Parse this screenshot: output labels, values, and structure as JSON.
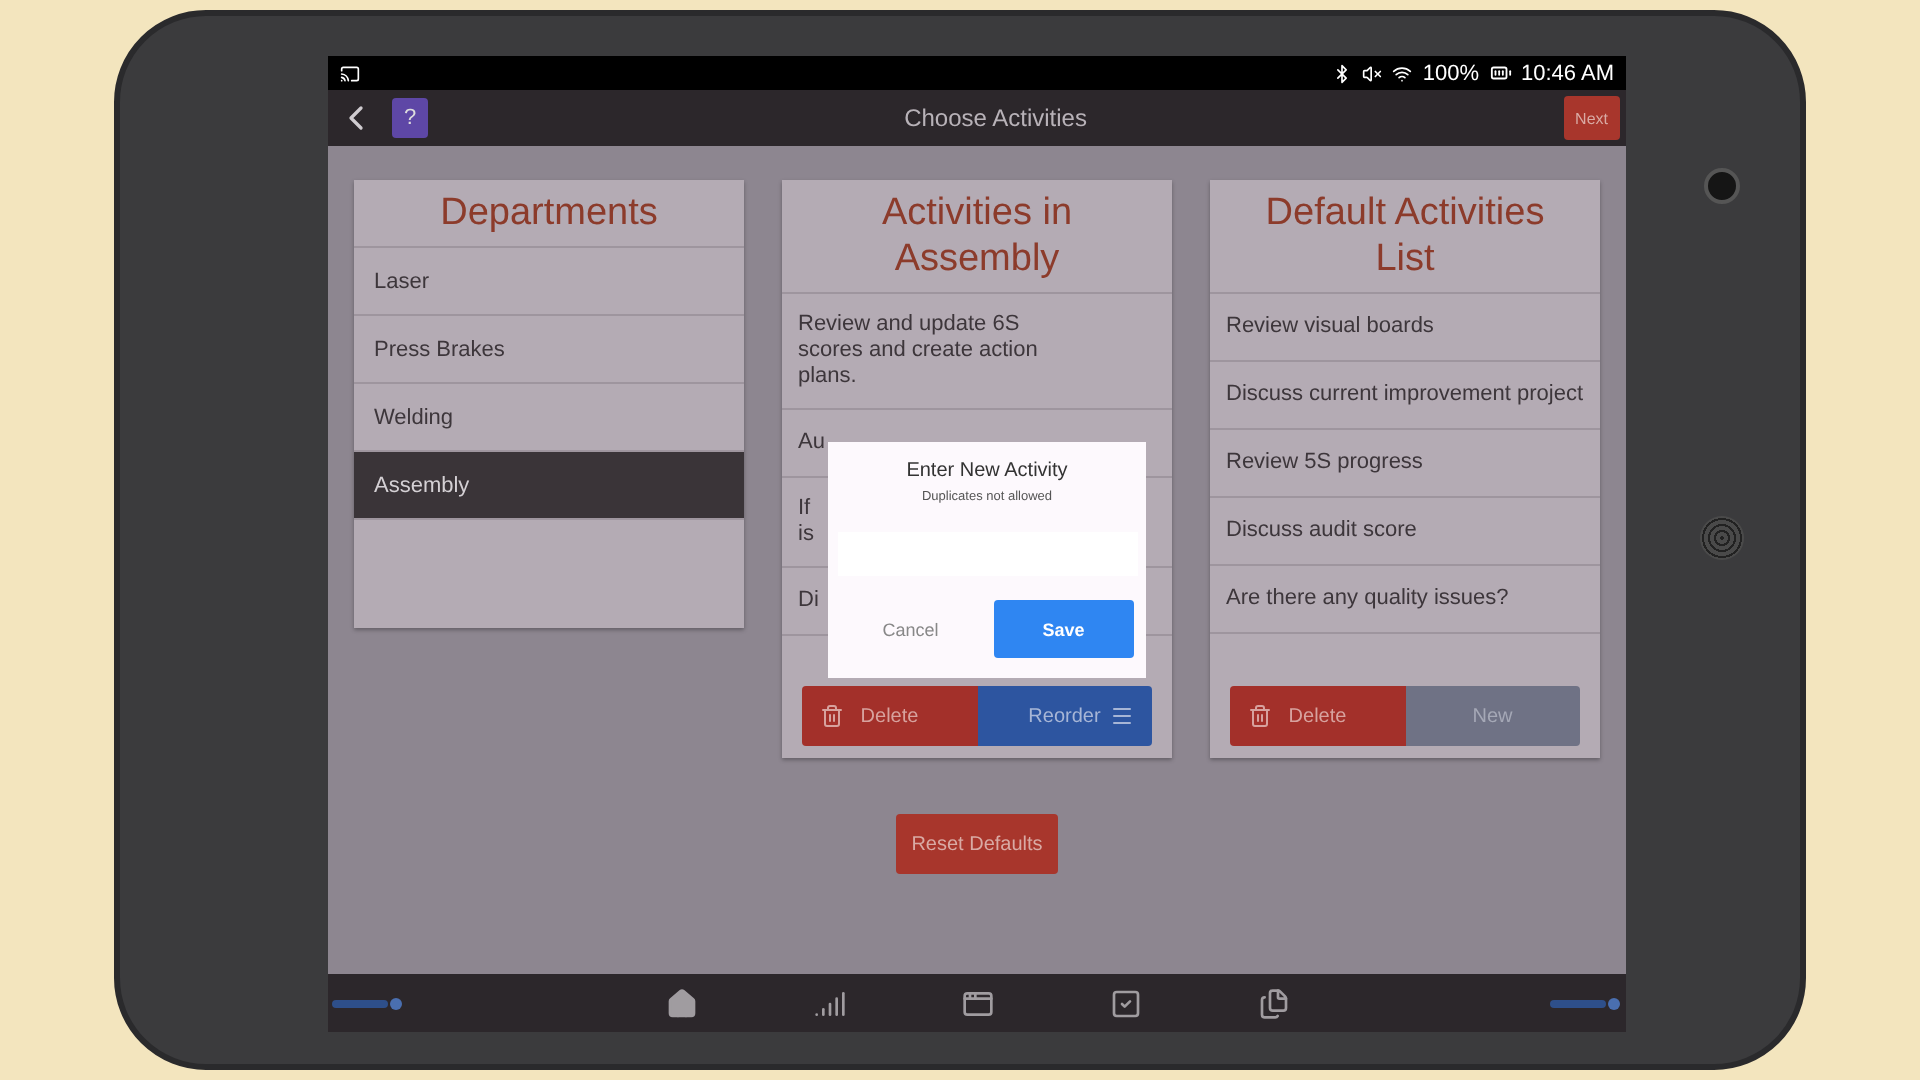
{
  "status_bar": {
    "battery": "100%",
    "time": "10:46 AM"
  },
  "top_bar": {
    "help": "?",
    "title": "Choose Activities",
    "next": "Next"
  },
  "departments": {
    "title": "Departments",
    "items": [
      {
        "label": "Laser",
        "selected": false
      },
      {
        "label": "Press Brakes",
        "selected": false
      },
      {
        "label": "Welding",
        "selected": false
      },
      {
        "label": "Assembly",
        "selected": true
      }
    ]
  },
  "activities": {
    "title": "Activities in Assembly",
    "items": [
      {
        "lines": [
          "Review and update 6S scores and create action plans."
        ]
      },
      {
        "lines": [
          "Au"
        ]
      },
      {
        "lines": [
          "If",
          "is"
        ]
      },
      {
        "lines": [
          "Di"
        ]
      }
    ],
    "buttons": [
      {
        "label": "Delete",
        "kind": "delete"
      },
      {
        "label": "Reorder",
        "kind": "reorder"
      }
    ]
  },
  "defaults": {
    "title": "Default Activities List",
    "items": [
      {
        "lines": [
          "Review visual boards"
        ]
      },
      {
        "lines": [
          "Discuss current improvement project"
        ]
      },
      {
        "lines": [
          "Review 5S progress"
        ]
      },
      {
        "lines": [
          "Discuss audit score"
        ]
      },
      {
        "lines": [
          "Are there any quality issues?"
        ]
      }
    ],
    "buttons": [
      {
        "label": "Delete",
        "kind": "delete"
      },
      {
        "label": "New",
        "kind": "new"
      }
    ]
  },
  "reset_button": "Reset Defaults",
  "dialog": {
    "title": "Enter New Activity",
    "subtitle": "Duplicates not allowed",
    "buttons": [
      {
        "label": "Cancel",
        "kind": "plain"
      },
      {
        "label": "Save",
        "kind": "primary"
      }
    ]
  },
  "bottom_nav": [
    {
      "kind": "home"
    },
    {
      "kind": "signal"
    },
    {
      "kind": "window"
    },
    {
      "kind": "check"
    },
    {
      "kind": "files"
    }
  ]
}
